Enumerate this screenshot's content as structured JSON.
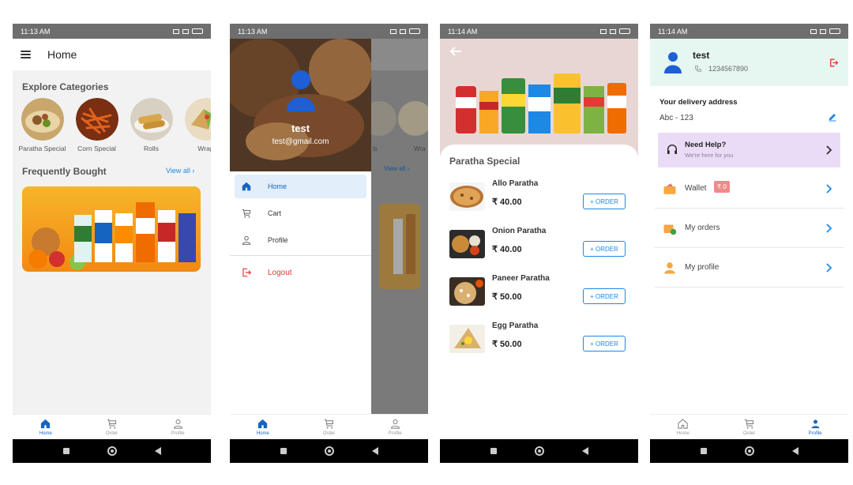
{
  "screens": {
    "home": {
      "status_time": "11:13 AM",
      "title": "Home",
      "explore_title": "Explore Categories",
      "categories": [
        {
          "label": "Paratha Special"
        },
        {
          "label": "Corn Special"
        },
        {
          "label": "Rolls"
        },
        {
          "label": "Wrap"
        }
      ],
      "frequently_title": "Frequently Bought",
      "view_all": "View all"
    },
    "drawer": {
      "status_time": "11:13 AM",
      "user_name": "test",
      "user_email": "test@gmail.com",
      "menu": [
        {
          "label": "Home",
          "icon": "home-icon",
          "active": true
        },
        {
          "label": "Cart",
          "icon": "cart-icon",
          "active": false
        },
        {
          "label": "Profile",
          "icon": "person-icon",
          "active": false
        }
      ],
      "logout_label": "Logout",
      "view_all": "View all",
      "behind_label": "Wra",
      "behind_label2": "ls"
    },
    "category": {
      "status_time": "11:14 AM",
      "title": "Paratha Special",
      "items": [
        {
          "name": "Allo Paratha",
          "price": "₹ 40.00",
          "button": "ORDER"
        },
        {
          "name": "Onion Paratha",
          "price": "₹ 40.00",
          "button": "ORDER"
        },
        {
          "name": "Paneer Paratha",
          "price": "₹ 50.00",
          "button": "ORDER"
        },
        {
          "name": "Egg Paratha",
          "price": "₹ 50.00",
          "button": "ORDER"
        }
      ]
    },
    "profile": {
      "status_time": "11:14 AM",
      "user_name": "test",
      "phone": "1234567890",
      "delivery_label": "Your delivery address",
      "address": "Abc - 123",
      "help_title": "Need Help?",
      "help_sub": "We're here for you",
      "rows": [
        {
          "label": "Wallet",
          "badge": "₹ 0",
          "icon": "wallet-icon"
        },
        {
          "label": "My orders",
          "icon": "orders-icon"
        },
        {
          "label": "My profile",
          "icon": "profile-icon"
        }
      ]
    }
  },
  "bottom_tabs": [
    {
      "label": "Home",
      "icon": "home-icon"
    },
    {
      "label": "Order",
      "icon": "cart-icon"
    },
    {
      "label": "Profile",
      "icon": "person-icon"
    }
  ],
  "colors": {
    "accent": "#1e88e5",
    "active_tab": "#1565c0",
    "logout": "#e53935",
    "help_bg": "#eadcf7",
    "profile_header_bg": "#e6f6f1"
  }
}
